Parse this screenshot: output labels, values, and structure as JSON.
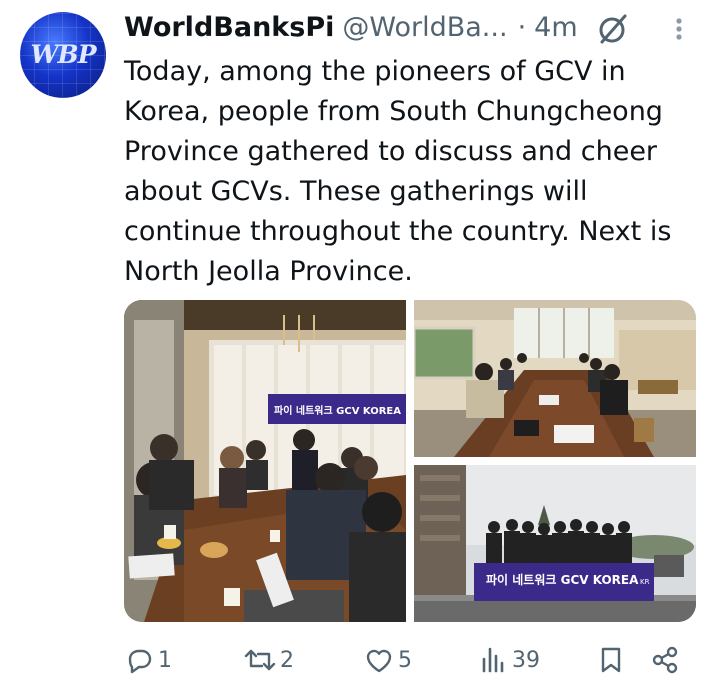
{
  "account": {
    "display_name": "WorldBanksPi",
    "handle": "@WorldBa...",
    "separator": "·",
    "time": "4m",
    "avatar_text": "WBP"
  },
  "tweet": {
    "text": "Today, among the pioneers of GCV in\nKorea, people from South Chungcheong\nProvince gathered to discuss and cheer\nabout GCVs. These gatherings will\ncontinue throughout the country. Next is\nNorth Jeolla Province."
  },
  "media": {
    "banner_text_1": "파이 네트워크 GCV KOREA",
    "banner_text_2": "파이 네트워크 GCV KOREA",
    "banner_suffix": "KR"
  },
  "actions": {
    "replies": "1",
    "reposts": "2",
    "likes": "5",
    "views": "39"
  },
  "colors": {
    "text": "#0f1419",
    "secondary": "#536471",
    "banner": "#3b2a8a"
  }
}
